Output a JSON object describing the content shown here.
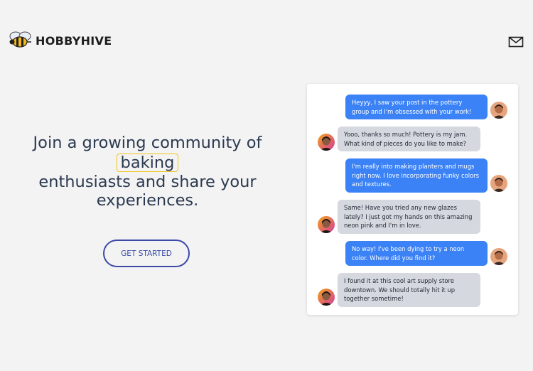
{
  "brand": {
    "name": "HOBBYHIVE",
    "logo_icon": "bee-icon"
  },
  "header": {
    "mail_icon": "envelope-icon"
  },
  "hero": {
    "line1": "Join a growing community of",
    "highlight": "baking",
    "line2": "enthusiasts and share your",
    "line3": "experiences."
  },
  "cta": {
    "label": "GET STARTED"
  },
  "chat": {
    "messages": [
      {
        "side": "out",
        "text": "Heyyy, I saw your post in the pottery group and I'm obsessed with your work!"
      },
      {
        "side": "in",
        "text": "Yooo, thanks so much! Pottery is my jam. What kind of pieces do you like to make?"
      },
      {
        "side": "out",
        "text": "I'm really into making planters and mugs right now. I love incorporating funky colors and textures."
      },
      {
        "side": "in",
        "text": "Same! Have you tried any new glazes lately? I just got my hands on this amazing neon pink and I'm in love."
      },
      {
        "side": "out",
        "text": "No way! I've been dying to try a neon color. Where did you find it?"
      },
      {
        "side": "in",
        "text": "I found it at this cool art supply store downtown. We should totally hit it up together sometime!"
      }
    ]
  },
  "colors": {
    "accent_blue": "#3b82f6",
    "cta_border": "#3a4aa6",
    "highlight_border": "#f0c419",
    "incoming_bubble": "#d6d8df"
  }
}
